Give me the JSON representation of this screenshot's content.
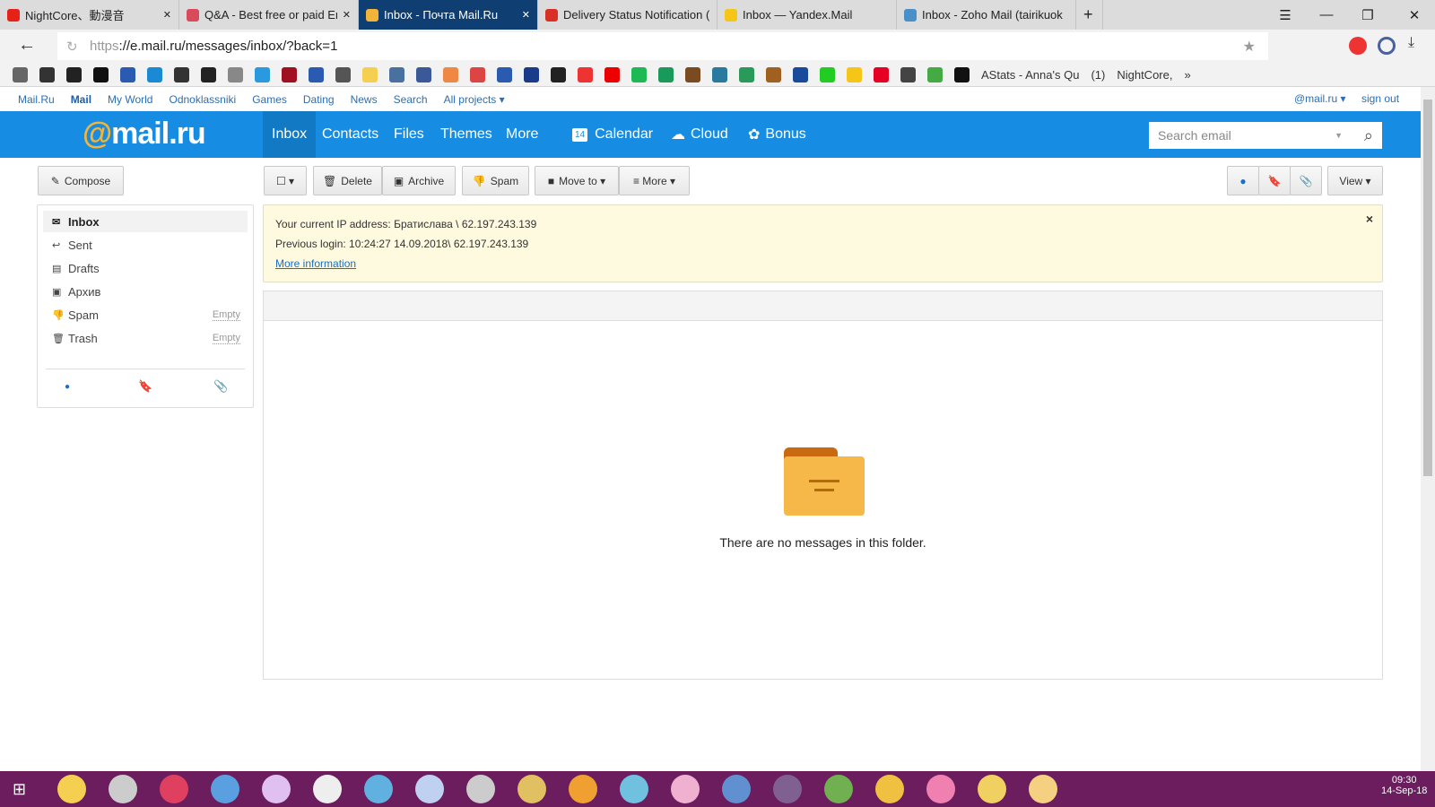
{
  "browser": {
    "tabs": [
      {
        "title": "NightCore、動漫音",
        "favicon": "#e62117"
      },
      {
        "title": "Q&A - Best free or paid Ema",
        "favicon": "#d94a5a"
      },
      {
        "title": "Inbox - Почта Mail.Ru",
        "favicon": "#f4b43a",
        "active": true
      },
      {
        "title": "Delivery Status Notification (",
        "favicon": "#d93025"
      },
      {
        "title": "Inbox — Yandex.Mail",
        "favicon": "#f5c518"
      },
      {
        "title": "Inbox - Zoho Mail (tairikuok",
        "favicon": "#4a90c8"
      }
    ],
    "url_scheme": "https",
    "url_rest": "://e.mail.ru/messages/inbox/?back=1",
    "bookmarks_icons": [
      "#666",
      "#333",
      "#222",
      "#111",
      "#2a5bb0",
      "#1a8ad4",
      "#333",
      "#222",
      "#888",
      "#2a9ae0",
      "#a01020",
      "#2a5bb0",
      "#555",
      "#f5d050",
      "#4a70a0",
      "#3b5998",
      "#e84",
      "#d44",
      "#2a5bb0",
      "#1a3a8a",
      "#222",
      "#e33",
      "#e00",
      "#1db954",
      "#1a9a5a",
      "#7a4a20",
      "#2a7aa0",
      "#2a9a5a",
      "#a06020",
      "#1a4a9a",
      "#2c2",
      "#f5c518",
      "#e60023",
      "#444",
      "#4a4",
      "#111"
    ],
    "bookmarks_text": [
      "AStats - Anna's Qu",
      "(1)",
      "NightCore,"
    ]
  },
  "portal": {
    "links": [
      "Mail.Ru",
      "Mail",
      "My World",
      "Odnoklassniki",
      "Games",
      "Dating",
      "News",
      "Search",
      "All projects ▾"
    ],
    "account": "@mail.ru ▾",
    "signout": "sign out"
  },
  "header": {
    "logo_at": "@",
    "logo_text": "mail.ru",
    "nav": [
      "Inbox",
      "Contacts",
      "Files",
      "Themes",
      "More"
    ],
    "calendar": "Calendar",
    "calendar_day": "14",
    "cloud": "Cloud",
    "bonus": "Bonus",
    "search_placeholder": "Search email"
  },
  "toolbar": {
    "compose": "Compose",
    "delete": "Delete",
    "archive": "Archive",
    "spam": "Spam",
    "move": "Move to ▾",
    "more": "≡ More ▾",
    "view": "View ▾"
  },
  "folders": [
    {
      "name": "Inbox",
      "icon": "✉"
    },
    {
      "name": "Sent",
      "icon": "↩"
    },
    {
      "name": "Drafts",
      "icon": "▤"
    },
    {
      "name": "Архив",
      "icon": "▣"
    },
    {
      "name": "Spam",
      "icon": "👎",
      "action": "Empty"
    },
    {
      "name": "Trash",
      "icon": "🗑",
      "action": "Empty"
    }
  ],
  "notice": {
    "ip": "Your current IP address: Братислава \\ 62.197.243.139",
    "login": "Previous login: 10:24:27 14.09.2018\\ 62.197.243.139",
    "link": "More information",
    "close": "×"
  },
  "empty": {
    "text": "There are no messages in this folder."
  },
  "colors": {
    "brand": "#168de2",
    "unread": "#1a6fc4",
    "flag": "#e8321f",
    "taskbar": "#6b1d5e"
  },
  "taskbar": {
    "time": "09:30",
    "date": "14-Sep-18",
    "apps": [
      "#f5d050",
      "#ccc",
      "#e04060",
      "#5aa0e0",
      "#e0c0f0",
      "#eee",
      "#60b0e0",
      "#c0d0f0",
      "#ccc",
      "#e0c060",
      "#f0a030",
      "#70c0e0",
      "#f0b0d0",
      "#6090d0",
      "#806090",
      "#70b050",
      "#f0c040",
      "#f080b0",
      "#f0d060",
      "#f5d080"
    ]
  }
}
